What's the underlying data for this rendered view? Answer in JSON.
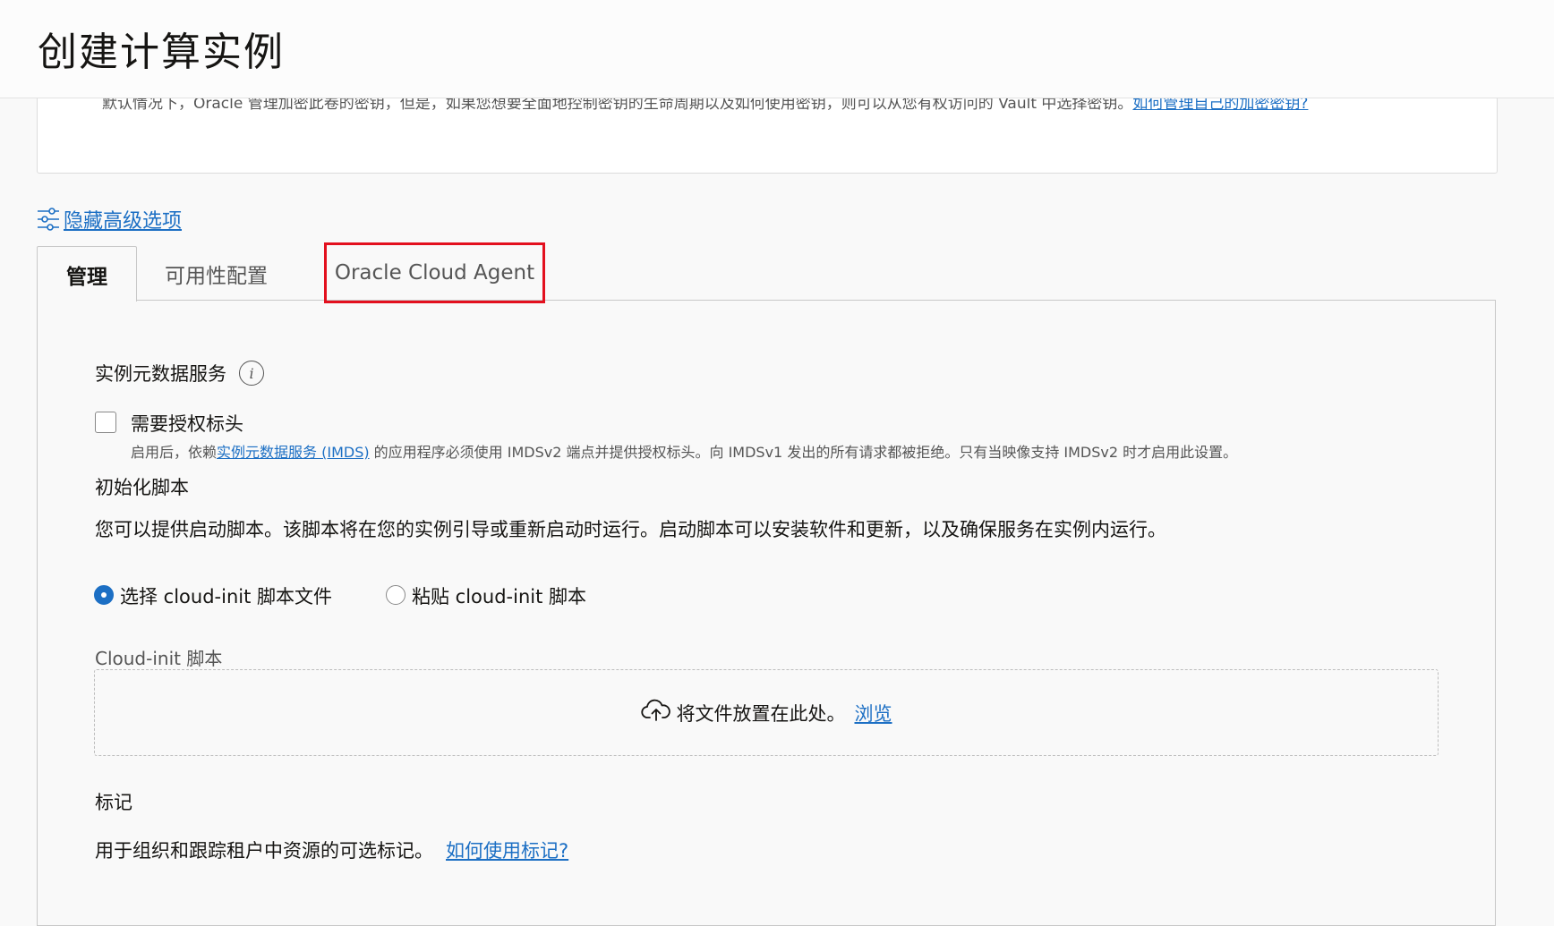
{
  "header": {
    "title": "创建计算实例"
  },
  "previous_section": {
    "text": "默认情况下，Oracle 管理加密此卷的密钥，但是，如果您想要全面地控制密钥的生命周期以及如何使用密钥，则可以从您有权访问的 Vault 中选择密钥。",
    "link": "如何管理自己的加密密钥?"
  },
  "advanced_toggle": {
    "label": "隐藏高级选项",
    "icon": "sliders-icon"
  },
  "tabs": [
    {
      "label": "管理",
      "active": true
    },
    {
      "label": "可用性配置",
      "active": false
    },
    {
      "label": "Oracle Cloud Agent",
      "active": false,
      "highlighted": true
    }
  ],
  "highlight_color": "#e3101e",
  "accent_color": "#1c6fc4",
  "imds": {
    "title": "实例元数据服务",
    "info_icon": "i",
    "checkbox_label": "需要授权标头",
    "checkbox_checked": false,
    "help_prefix": "启用后，依赖",
    "help_link": "实例元数据服务 (IMDS)",
    "help_suffix": " 的应用程序必须使用 IMDSv2 端点并提供授权标头。向 IMDSv1 发出的所有请求都被拒绝。只有当映像支持 IMDSv2 时才启用此设置。"
  },
  "init_script": {
    "title": "初始化脚本",
    "description": "您可以提供启动脚本。该脚本将在您的实例引导或重新启动时运行。启动脚本可以安装软件和更新，以及确保服务在实例内运行。",
    "options": [
      {
        "label": "选择 cloud-init 脚本文件",
        "selected": true
      },
      {
        "label": "粘贴 cloud-init 脚本",
        "selected": false
      }
    ],
    "field_label": "Cloud-init 脚本",
    "dropzone_text": "将文件放置在此处。",
    "browse_label": "浏览",
    "upload_icon": "cloud-upload-icon"
  },
  "tags": {
    "title": "标记",
    "description": "用于组织和跟踪租户中资源的可选标记。",
    "link": "如何使用标记?"
  }
}
